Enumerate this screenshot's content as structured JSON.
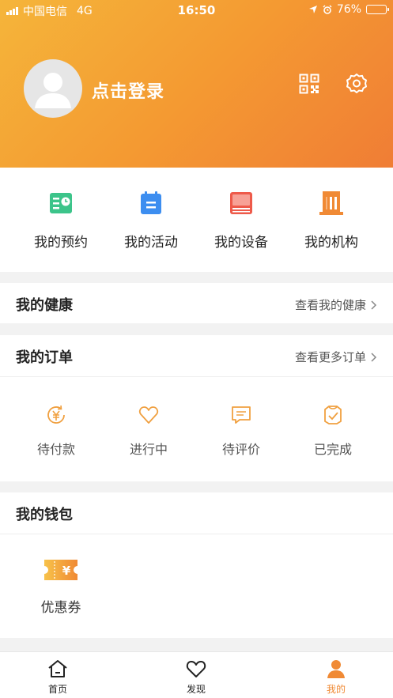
{
  "status_bar": {
    "carrier": "中国电信",
    "network": "4G",
    "time": "16:50",
    "battery": "76%",
    "battery_level": 0.76
  },
  "profile": {
    "login_label": "点击登录"
  },
  "quick_actions": [
    {
      "label": "我的预约",
      "icon": "appointment-icon",
      "color": "#3cc48a"
    },
    {
      "label": "我的活动",
      "icon": "activity-icon",
      "color": "#3d8ef0"
    },
    {
      "label": "我的设备",
      "icon": "device-icon",
      "color": "#ee5a4a"
    },
    {
      "label": "我的机构",
      "icon": "institution-icon",
      "color": "#f08a35"
    }
  ],
  "health": {
    "title": "我的健康",
    "link": "查看我的健康"
  },
  "orders": {
    "title": "我的订单",
    "link": "查看更多订单",
    "items": [
      {
        "label": "待付款",
        "icon": "pending-payment-icon"
      },
      {
        "label": "进行中",
        "icon": "in-progress-icon"
      },
      {
        "label": "待评价",
        "icon": "pending-review-icon"
      },
      {
        "label": "已完成",
        "icon": "completed-icon"
      }
    ]
  },
  "wallet": {
    "title": "我的钱包",
    "coupon_label": "优惠券",
    "coupon_symbol": "¥"
  },
  "tabbar": [
    {
      "label": "首页",
      "icon": "home-icon",
      "active": false
    },
    {
      "label": "发现",
      "icon": "heart-icon",
      "active": false
    },
    {
      "label": "我的",
      "icon": "person-icon",
      "active": true
    }
  ],
  "colors": {
    "accent": "#f08a35",
    "hero_start": "#f5b53a",
    "hero_end": "#f07d35"
  }
}
